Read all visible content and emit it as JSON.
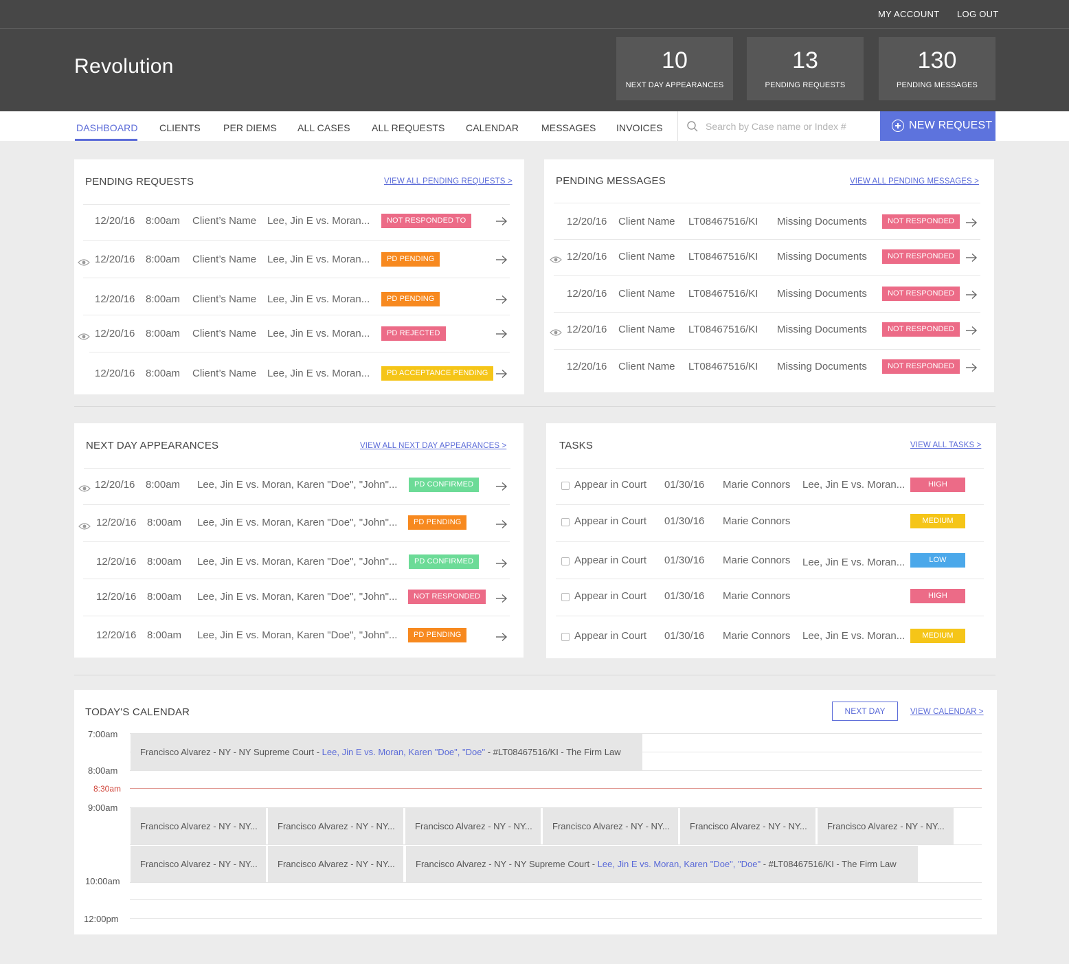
{
  "header": {
    "my_account": "MY ACCOUNT",
    "log_out": "LOG OUT",
    "brand": "Revolution",
    "stats": [
      {
        "num": "10",
        "label": "NEXT DAY APPEARANCES"
      },
      {
        "num": "13",
        "label": "PENDING REQUESTS"
      },
      {
        "num": "130",
        "label": "PENDING MESSAGES"
      }
    ]
  },
  "nav": {
    "items": [
      "DASHBOARD",
      "CLIENTS",
      "PER DIEMS",
      "ALL CASES",
      "ALL REQUESTS",
      "CALENDAR",
      "MESSAGES",
      "INVOICES"
    ],
    "active": "DASHBOARD",
    "search_placeholder": "Search by Case name or Index #",
    "new_request": "NEW REQUEST"
  },
  "pending_requests": {
    "title": "PENDING REQUESTS",
    "view_all": "VIEW ALL PENDING REQUESTS  >",
    "rows": [
      {
        "date": "12/20/16",
        "time": "8:00am",
        "client": "Client’s Name",
        "case": "Lee, Jin E vs. Moran...",
        "status": "NOT RESPONDED TO",
        "color": "#ec6b87",
        "eye": false
      },
      {
        "date": "12/20/16",
        "time": "8:00am",
        "client": "Client’s Name",
        "case": "Lee, Jin E vs. Moran...",
        "status": "PD PENDING",
        "color": "#f7891f",
        "eye": true
      },
      {
        "date": "12/20/16",
        "time": "8:00am",
        "client": "Client’s Name",
        "case": "Lee, Jin E vs. Moran...",
        "status": "PD PENDING",
        "color": "#f7891f",
        "eye": false
      },
      {
        "date": "12/20/16",
        "time": "8:00am",
        "client": "Client’s Name",
        "case": "Lee, Jin E vs. Moran...",
        "status": "PD REJECTED",
        "color": "#ec6b87",
        "eye": true
      },
      {
        "date": "12/20/16",
        "time": "8:00am",
        "client": "Client’s Name",
        "case": "Lee, Jin E vs. Moran...",
        "status": "PD ACCEPTANCE PENDING",
        "color": "#f5c518",
        "eye": false
      }
    ]
  },
  "pending_messages": {
    "title": "PENDING MESSAGES",
    "view_all": "VIEW ALL PENDING MESSAGES >",
    "rows": [
      {
        "date": "12/20/16",
        "client": "Client Name",
        "index": "LT08467516/KI",
        "subject": "Missing Documents",
        "status": "NOT RESPONDED",
        "eye": false
      },
      {
        "date": "12/20/16",
        "client": "Client Name",
        "index": "LT08467516/KI",
        "subject": "Missing Documents",
        "status": "NOT RESPONDED",
        "eye": true
      },
      {
        "date": "12/20/16",
        "client": "Client Name",
        "index": "LT08467516/KI",
        "subject": "Missing Documents",
        "status": "NOT RESPONDED",
        "eye": false
      },
      {
        "date": "12/20/16",
        "client": "Client Name",
        "index": "LT08467516/KI",
        "subject": "Missing Documents",
        "status": "NOT RESPONDED",
        "eye": true
      },
      {
        "date": "12/20/16",
        "client": "Client Name",
        "index": "LT08467516/KI",
        "subject": "Missing Documents",
        "status": "NOT RESPONDED",
        "eye": false
      }
    ]
  },
  "next_day_appearances": {
    "title": "NEXT DAY APPEARANCES",
    "view_all": "VIEW ALL NEXT DAY APPEARANCES  >",
    "rows": [
      {
        "date": "12/20/16",
        "time": "8:00am",
        "case": "Lee, Jin E vs. Moran, Karen \"Doe\", \"John\"...",
        "status": "PD CONFIRMED",
        "color": "#6cdb97",
        "eye": true
      },
      {
        "date": "12/20/16",
        "time": "8:00am",
        "case": "Lee, Jin E vs. Moran, Karen \"Doe\", \"John\"...",
        "status": "PD PENDING",
        "color": "#f7891f",
        "eye": true
      },
      {
        "date": "12/20/16",
        "time": "8:00am",
        "case": "Lee, Jin E vs. Moran, Karen \"Doe\", \"John\"...",
        "status": "PD CONFIRMED",
        "color": "#6cdb97",
        "eye": false
      },
      {
        "date": "12/20/16",
        "time": "8:00am",
        "case": "Lee, Jin E vs. Moran, Karen \"Doe\", \"John\"...",
        "status": "NOT RESPONDED",
        "color": "#ec6b87",
        "eye": false
      },
      {
        "date": "12/20/16",
        "time": "8:00am",
        "case": "Lee, Jin E vs. Moran, Karen \"Doe\", \"John\"...",
        "status": "PD PENDING",
        "color": "#f7891f",
        "eye": false
      }
    ]
  },
  "tasks": {
    "title": "TASKS",
    "view_all": "VIEW ALL TASKS >",
    "rows": [
      {
        "task": "Appear in Court",
        "date": "01/30/16",
        "person": "Marie Connors",
        "case": "Lee, Jin E vs. Moran...",
        "priority": "HIGH",
        "color": "#ec6b87"
      },
      {
        "task": "Appear in Court",
        "date": "01/30/16",
        "person": "Marie Connors",
        "case": "",
        "priority": "MEDIUM",
        "color": "#f5c518"
      },
      {
        "task": "Appear in Court",
        "date": "01/30/16",
        "person": "Marie Connors",
        "case": "Lee, Jin E vs. Moran...",
        "priority": "LOW",
        "color": "#4ba8ea"
      },
      {
        "task": "Appear in Court",
        "date": "01/30/16",
        "person": "Marie Connors",
        "case": "",
        "priority": "HIGH",
        "color": "#ec6b87"
      },
      {
        "task": "Appear in Court",
        "date": "01/30/16",
        "person": "Marie Connors",
        "case": "Lee, Jin E vs. Moran...",
        "priority": "MEDIUM",
        "color": "#f5c518"
      }
    ]
  },
  "calendar": {
    "title": "TODAY'S CALENDAR",
    "next_day": "NEXT DAY",
    "view_calendar": "VIEW CALENDAR  >",
    "times": [
      "7:00am",
      "8:00am",
      "8:30am",
      "9:00am",
      "10:00am",
      "12:00pm"
    ],
    "current_time": "8:30am",
    "event_full": {
      "pre": "Francisco Alvarez - NY - NY Supreme Court - ",
      "link": "Lee, Jin E vs. Moran, Karen \"Doe\", \"Doe\"",
      "post": " - #LT08467516/KI - The Firm Law"
    },
    "event_short": "Francisco Alvarez - NY - NY..."
  }
}
